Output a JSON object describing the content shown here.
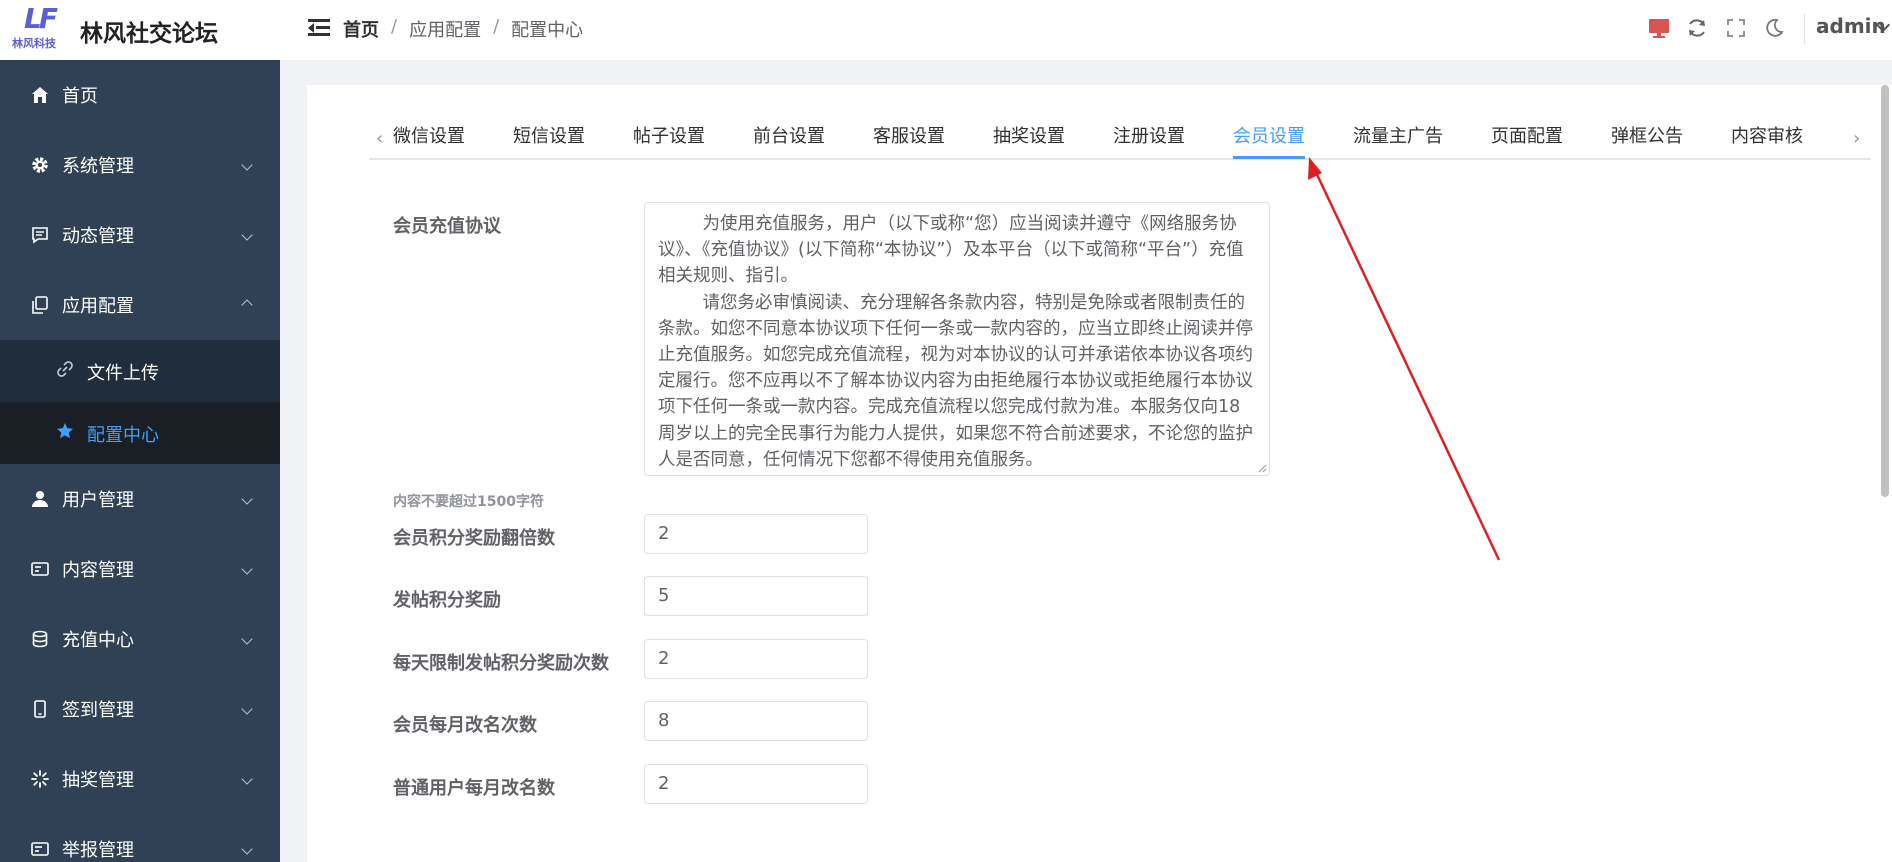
{
  "app": {
    "logo_text": "LF",
    "logo_subtext": "林风科技",
    "title": "林风社交论坛"
  },
  "breadcrumb": [
    "首页",
    "应用配置",
    "配置中心"
  ],
  "header": {
    "user": "admin",
    "icons": [
      "monitor-icon",
      "refresh-icon",
      "fullscreen-icon",
      "dark-mode-icon"
    ],
    "monitor_color": "#d9534f"
  },
  "sidebar": {
    "items": [
      {
        "label": "首页",
        "icon": "home-icon"
      },
      {
        "label": "系统管理",
        "icon": "gear-icon"
      },
      {
        "label": "动态管理",
        "icon": "message-icon"
      },
      {
        "label": "应用配置",
        "icon": "copy-icon",
        "expanded": true
      },
      {
        "label": "文件上传",
        "icon": "link-icon",
        "sub": true
      },
      {
        "label": "配置中心",
        "icon": "star-icon",
        "sub": true,
        "active": true
      },
      {
        "label": "用户管理",
        "icon": "user-icon"
      },
      {
        "label": "内容管理",
        "icon": "card-icon"
      },
      {
        "label": "充值中心",
        "icon": "database-icon"
      },
      {
        "label": "签到管理",
        "icon": "phone-icon"
      },
      {
        "label": "抽奖管理",
        "icon": "loading-icon"
      },
      {
        "label": "举报管理",
        "icon": "report-icon"
      }
    ]
  },
  "tabs": [
    "微信设置",
    "短信设置",
    "帖子设置",
    "前台设置",
    "客服设置",
    "抽奖设置",
    "注册设置",
    "会员设置",
    "流量主广告",
    "页面配置",
    "弹框公告",
    "内容审核"
  ],
  "active_tab": "会员设置",
  "form": {
    "agreement_label": "会员充值协议",
    "agreement_text": "        为使用充值服务，用户（以下或称“您）应当阅读并遵守《网络服务协议》、《充值协议》(以下简称“本协议”）及本平台（以下或简称“平台”）充值相关规则、指引。\n        请您务必审慎阅读、充分理解各条款内容，特别是免除或者限制责任的条款。如您不同意本协议项下任何一条或一款内容的，应当立即终止阅读并停止充值服务。如您完成充值流程，视为对本协议的认可并承诺依本协议各项约定履行。您不应再以不了解本协议内容为由拒绝履行本协议或拒绝履行本协议项下任何一条或一款内容。完成充值流程以您完成付款为准。本服务仅向18周岁以上的完全民事行为能力人提供，如果您不符合前述要求，不论您的监护人是否同意，任何情况下您都不得使用充值服务。",
    "hint": "内容不要超过1500字符",
    "fields": [
      {
        "label": "会员积分奖励翻倍数",
        "value": "2"
      },
      {
        "label": "发帖积分奖励",
        "value": "5"
      },
      {
        "label": "每天限制发帖积分奖励次数",
        "value": "2"
      },
      {
        "label": "会员每月改名次数",
        "value": "8"
      },
      {
        "label": "普通用户每月改名数",
        "value": "2"
      }
    ]
  },
  "colors": {
    "sidebar_bg": "#304156",
    "accent": "#409eff",
    "annotation_arrow": "#e02020"
  }
}
